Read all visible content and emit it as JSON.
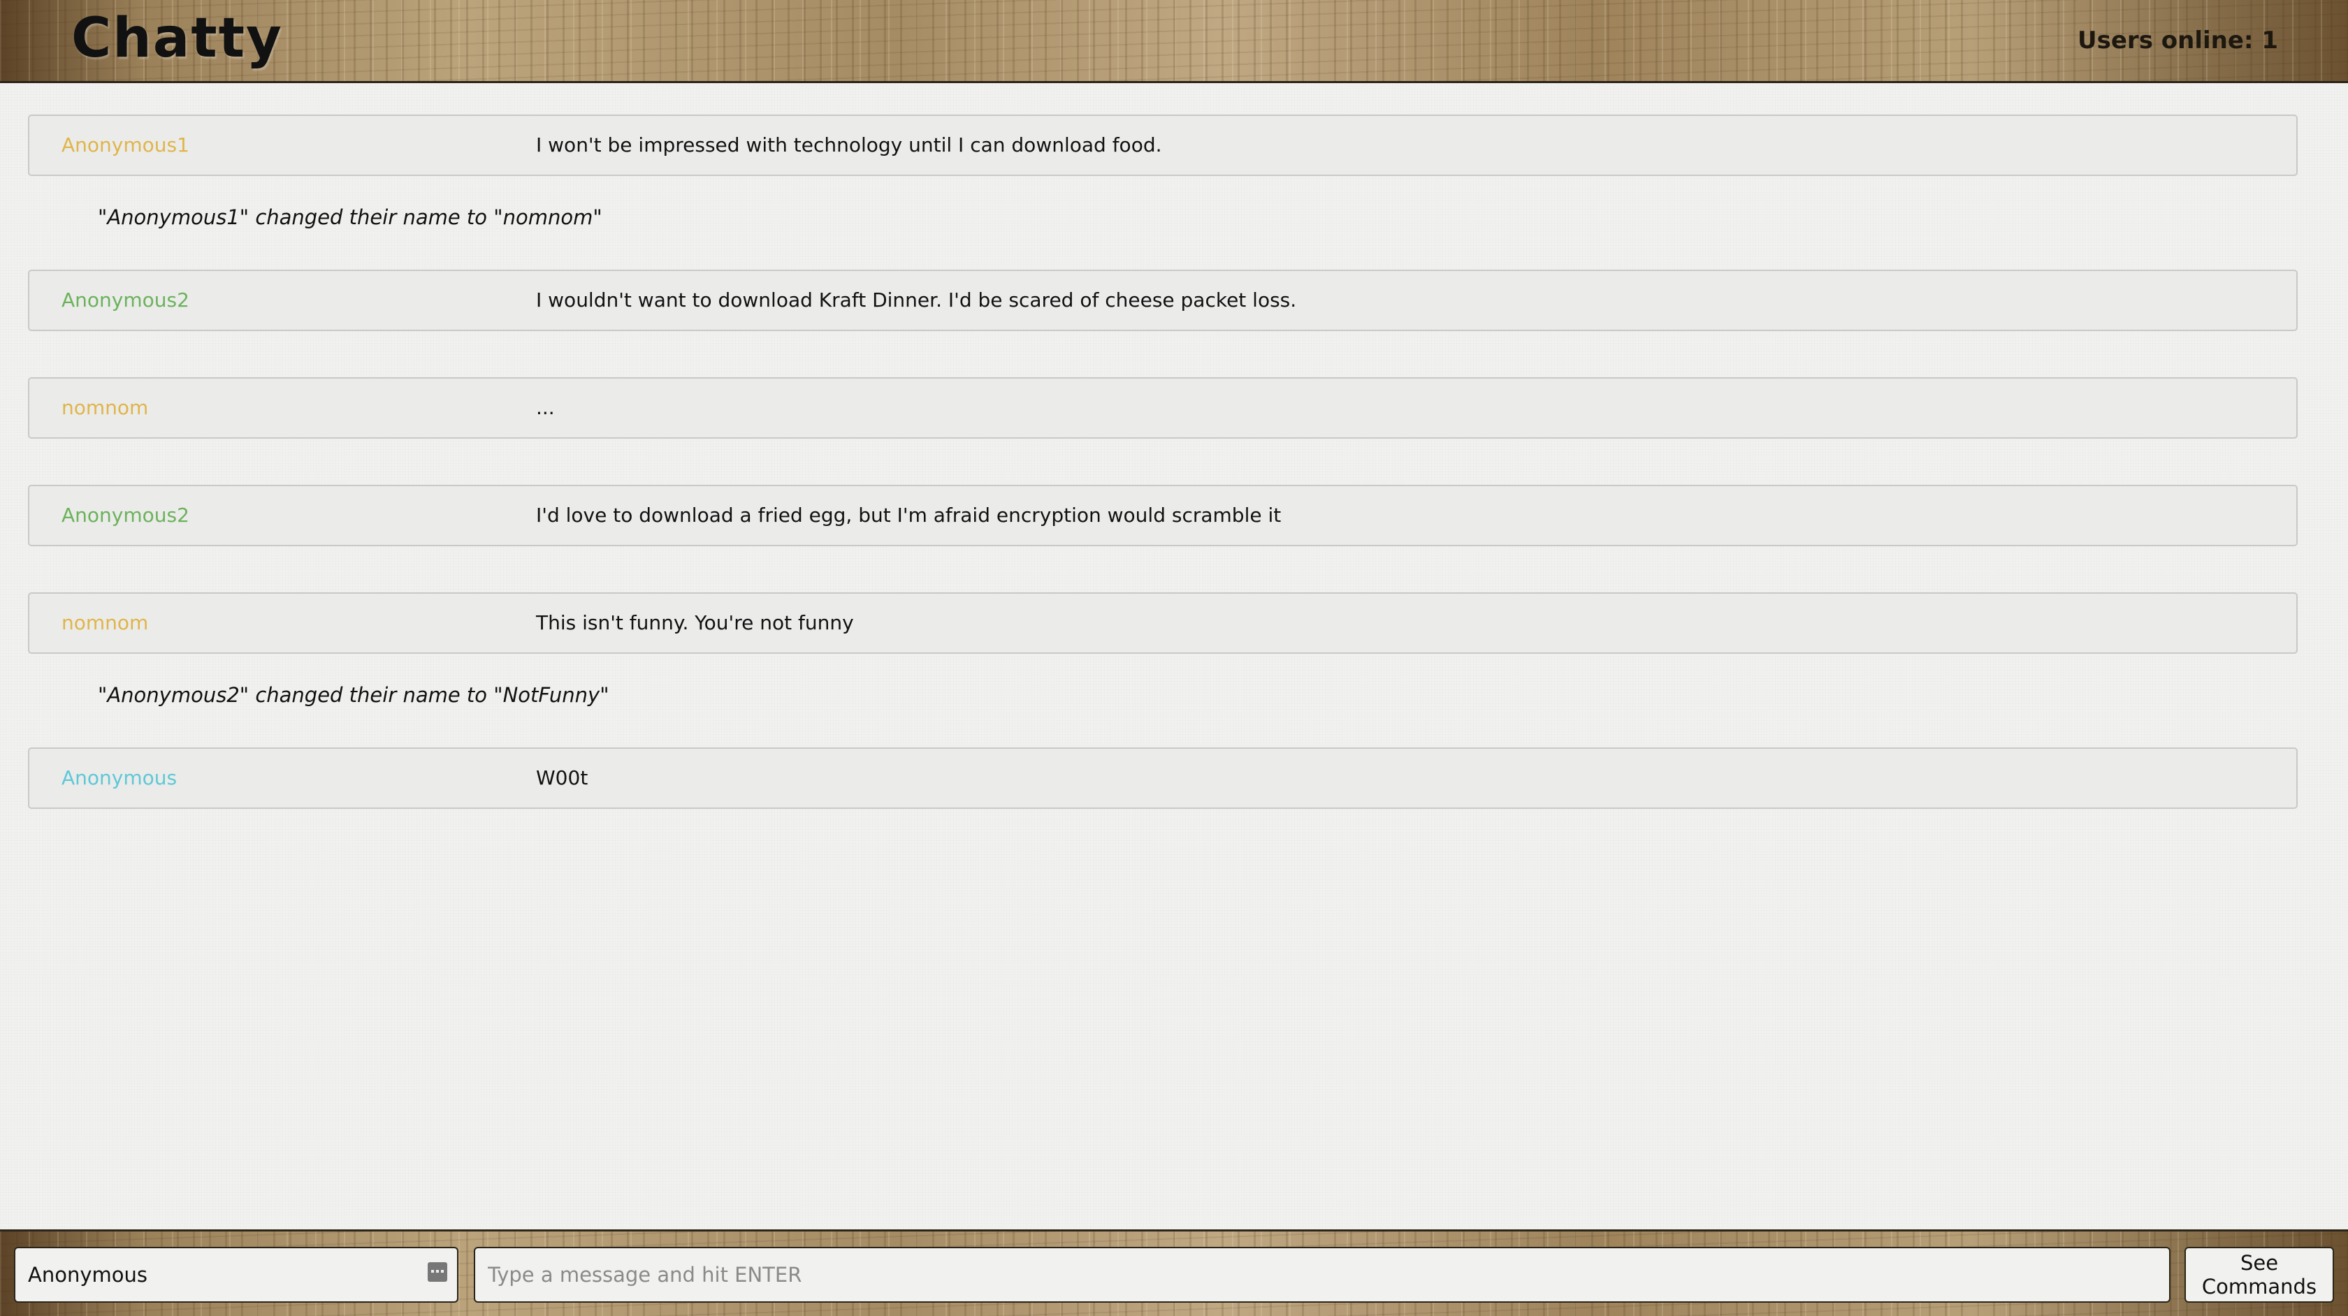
{
  "header": {
    "title": "Chatty",
    "users_online": "Users online: 1"
  },
  "colors": {
    "user_gold": "#e0b54a",
    "user_green": "#6bb25b",
    "user_cyan": "#5ec8d6"
  },
  "messages": [
    {
      "type": "message",
      "user": "Anonymous1",
      "user_color": "#e0b54a",
      "text": "I won't be impressed with technology until I can download food."
    },
    {
      "type": "notice",
      "text": "\"Anonymous1\" changed their name to \"nomnom\""
    },
    {
      "type": "message",
      "user": "Anonymous2",
      "user_color": "#6bb25b",
      "text": "I wouldn't want to download Kraft Dinner. I'd be scared of cheese packet loss."
    },
    {
      "type": "message",
      "user": "nomnom",
      "user_color": "#e0b54a",
      "text": "..."
    },
    {
      "type": "message",
      "user": "Anonymous2",
      "user_color": "#6bb25b",
      "text": "I'd love to download a fried egg, but I'm afraid encryption would scramble it"
    },
    {
      "type": "message",
      "user": "nomnom",
      "user_color": "#e0b54a",
      "text": "This isn't funny. You're not funny"
    },
    {
      "type": "notice",
      "text": "\"Anonymous2\" changed their name to \"NotFunny\""
    },
    {
      "type": "message",
      "user": "Anonymous",
      "user_color": "#5ec8d6",
      "text": "W00t"
    }
  ],
  "footer": {
    "username_value": "Anonymous",
    "username_icon": "more-icon",
    "message_placeholder": "Type a message and hit ENTER",
    "commands_label": "See Commands"
  }
}
